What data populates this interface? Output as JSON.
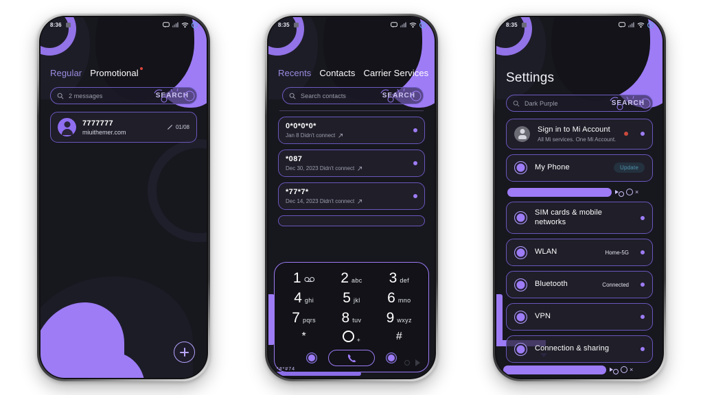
{
  "meta": {
    "accent": "#9d7cf6",
    "screen_bg": "#17171e",
    "card_bg": "#22212e",
    "card_border": "#6b57bd",
    "red_dot": "#c94a3d"
  },
  "phones": [
    {
      "id": "messages",
      "status": {
        "time": "8:36",
        "icons": [
          "message-icon",
          "signal-icon",
          "wifi-icon",
          "battery-icon"
        ]
      },
      "tabs": [
        {
          "label": "Regular",
          "active": false
        },
        {
          "label": "Promotional",
          "active": true,
          "badge": true
        }
      ],
      "search": {
        "placeholder": "2 messages",
        "button_label": "SEARCH",
        "icon": "search-icon"
      },
      "messages": [
        {
          "name": "7777777",
          "preview": "miuithemer.com",
          "date": "01/08",
          "meta_icon": "pencil-icon"
        }
      ],
      "fab": {
        "icon": "plus-icon",
        "label": "New message"
      }
    },
    {
      "id": "dialer",
      "status": {
        "time": "8:35",
        "icons": [
          "message-icon",
          "signal-icon",
          "wifi-icon",
          "battery-icon"
        ]
      },
      "tabs": [
        {
          "label": "Recents",
          "active": false
        },
        {
          "label": "Contacts",
          "active": true
        },
        {
          "label": "Carrier Services",
          "active": false
        }
      ],
      "search": {
        "placeholder": "Search contacts",
        "button_label": "SEARCH",
        "icon": "search-icon"
      },
      "calls": [
        {
          "number": "0*0*0*0*",
          "detail": "Jan 8 Didn't connect",
          "icon": "outgoing-call-icon"
        },
        {
          "number": "*087",
          "detail": "Dec 30, 2023 Didn't connect",
          "icon": "outgoing-call-icon"
        },
        {
          "number": "*77*7*",
          "detail": "Dec 14, 2023 Didn't connect",
          "icon": "outgoing-call-icon"
        }
      ],
      "keypad": {
        "keys": [
          {
            "num": "1",
            "letters": "",
            "voicemail": "∞"
          },
          {
            "num": "2",
            "letters": "abc"
          },
          {
            "num": "3",
            "letters": "def"
          },
          {
            "num": "4",
            "letters": "ghi"
          },
          {
            "num": "5",
            "letters": "jkl"
          },
          {
            "num": "6",
            "letters": "mno"
          },
          {
            "num": "7",
            "letters": "pqrs"
          },
          {
            "num": "8",
            "letters": "tuv"
          },
          {
            "num": "9",
            "letters": "wxyz"
          }
        ],
        "star": "*",
        "zero": "0",
        "zero_alt": "+",
        "hash": "#",
        "call_icon": "phone-icon",
        "left_key": "keypad-left-dot",
        "right_key": "keypad-right-dot"
      },
      "bottom_text": "*#*#74"
    },
    {
      "id": "settings",
      "status": {
        "time": "8:35",
        "icons": [
          "message-icon",
          "signal-icon",
          "wifi-icon",
          "battery-icon"
        ]
      },
      "title": "Settings",
      "search": {
        "placeholder": "Dark Purple",
        "button_label": "SEARCH",
        "icon": "search-icon"
      },
      "items": [
        {
          "type": "account",
          "title": "Sign in to Mi Account",
          "subtitle": "All Mi services. One Mi Account.",
          "value": "",
          "badge": "",
          "red_dot": true,
          "icon": "person-icon"
        },
        {
          "type": "row",
          "title": "My Phone",
          "subtitle": "",
          "value": "",
          "badge": "Update",
          "red_dot": false,
          "icon": "ring-icon"
        },
        {
          "type": "row",
          "title": "SIM cards & mobile networks",
          "subtitle": "",
          "value": "",
          "badge": "",
          "red_dot": false,
          "icon": "ring-icon"
        },
        {
          "type": "row",
          "title": "WLAN",
          "subtitle": "",
          "value": "Home-5G",
          "badge": "",
          "red_dot": false,
          "icon": "ring-icon"
        },
        {
          "type": "row",
          "title": "Bluetooth",
          "subtitle": "",
          "value": "Connected",
          "badge": "",
          "red_dot": false,
          "icon": "ring-icon"
        },
        {
          "type": "row",
          "title": "VPN",
          "subtitle": "",
          "value": "",
          "badge": "",
          "red_dot": false,
          "icon": "ring-icon"
        },
        {
          "type": "row",
          "title": "Connection & sharing",
          "subtitle": "",
          "value": "",
          "badge": "",
          "red_dot": false,
          "icon": "ring-icon"
        }
      ],
      "nav_icons": [
        "back-triangle-icon",
        "home-circle-icon",
        "recents-x-icon"
      ]
    }
  ]
}
